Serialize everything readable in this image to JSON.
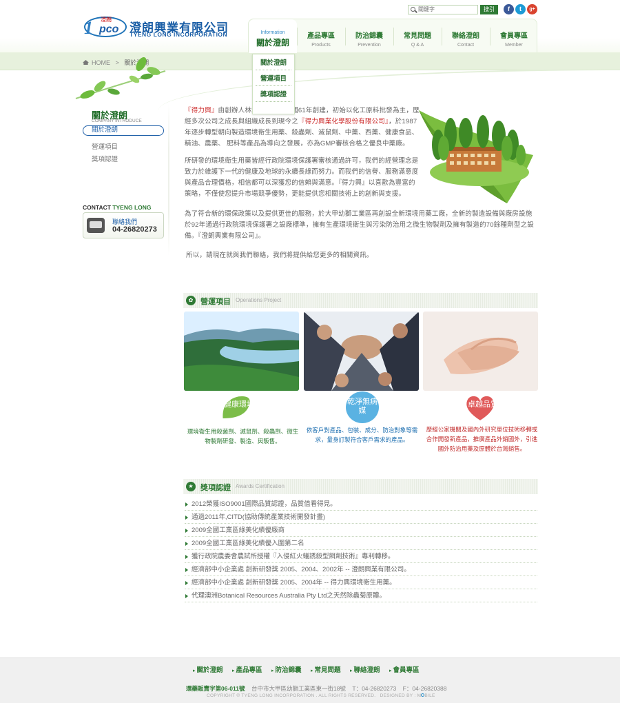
{
  "logo": {
    "mark_sub": "澄朗",
    "mark_num": "1",
    "mark_txt": "pco",
    "name_cn": "澄朗興業有限公司",
    "name_en": "TYENG LONG INCORPORATION"
  },
  "search": {
    "placeholder": "關鍵字",
    "button": "搜引"
  },
  "social": [
    "f",
    "t",
    "g+"
  ],
  "nav": [
    {
      "zh": "關於澄朗",
      "en": "Information"
    },
    {
      "zh": "產品專區",
      "en": "Products"
    },
    {
      "zh": "防治錦囊",
      "en": "Prevention"
    },
    {
      "zh": "常見問題",
      "en": "Q & A"
    },
    {
      "zh": "聯絡澄朗",
      "en": "Contact"
    },
    {
      "zh": "會員專區",
      "en": "Member"
    }
  ],
  "dropdown": [
    "關於澄朗",
    "營運項目",
    "獎項認證"
  ],
  "breadcrumb": {
    "home": "HOME",
    "sep": ">",
    "current": "關於澄朗"
  },
  "sidebar": {
    "title": "關於澄朗",
    "subtitle": "COMPANY INTRODUCE",
    "items": [
      "關於澄朗",
      "營運項目",
      "獎項認證"
    ]
  },
  "contact": {
    "heading_a": "CONTACT",
    "heading_b": "TYENG LONG",
    "label": "聯絡我們",
    "phone": "04-26820273"
  },
  "intro": {
    "p1_a": "『得力興』",
    "p1_b": "由創辦人林清德先生於民國61年創建，初始以化工原料批發為主，歷經多次公司之成長與組織成長到現今之",
    "p1_c": "『得力興業化學股份有限公司』",
    "p1_d": "，於1987年逐步轉型朝向製造環境衛生用藥、殺蟲劑、滅鼠劑、中藥、西藥、健康食品、精油、農藥、 肥料等產品為導向之發展，亦為GMP審核合格之優良中藥廠。",
    "p2": "所研發的環境衛生用藥皆經行政院環境保護署審核通過許可，我們的經營理念是致力於維護下一代的健康及地球的永續長綠而努力。而我們的信譽、服務滿意度與產品合理價格，相信都可以深獲您的信賴與滿意。『得力興』以喜歡為豐富的策略，不僅使您提升市場競爭優勢，更能提供您相關技術上的創新與支援。",
    "p3": "為了符合新的環保政策以及提供更佳的服務，於大甲幼獅工業區再創設全新環境用藥工廠，全新的製造設備與廠房設施於92年通過行政院環境保護署之設廠標準，擁有生產環境衛生與污染防治用之微生物製劑及擁有製造的70餘種劑型之設備。『澄朗興業有限公司』。",
    "p4": "所以，請現在就與我們聯絡，我們將提供給您更多的相關資訊。"
  },
  "operations": {
    "title_zh": "營運項目",
    "title_en": "Operations Project",
    "cards": [
      {
        "badge": "健康環境",
        "color": "#5aa83a",
        "text": "環境衛生用殺菌劑、滅鼠劑、殺蟲劑、微生物製劑研發、製造、與販售。"
      },
      {
        "badge": "乾淨無病媒",
        "color": "#2b8fc9",
        "text": "依客戶對產品、包裝、成分、防治對象等需求，量身訂製符合客戶需求的產品。"
      },
      {
        "badge": "卓越品質",
        "color": "#d23a3a",
        "text": "歷經公家機關及國內外研究單位技術移轉或合作開發新產品，推廣產品外銷國外，引進國外防治用藥及原體於台灣銷售。"
      }
    ]
  },
  "awards": {
    "title_zh": "獎項認證",
    "title_en": "Awards Certification",
    "items": [
      "2012榮獲ISO9001國際品質認證，品質值看得見。",
      "通過2011年,CITD(協助傳統產業技術開發計畫)",
      "2009全國工業區綠美化績優廠商",
      "2009全國工業區綠美化績優入圍第二名",
      "獲行政院農委會農試所授權『入侵紅火蟻誘殺型餌劑技術』專利轉移。",
      "經濟部中小企業處 創新研發獎 2005、2004、2002年 -- 澄朗興業有限公司。",
      "經濟部中小企業處 創新研發獎 2005、2004年 -- 得力興環境衛生用藥。",
      "代理澳洲Botanical Resources Australia Pty Ltd之天然除蟲菊原體。"
    ]
  },
  "footer": {
    "nav": [
      "關於澄朗",
      "產品專區",
      "防治錦囊",
      "常見問題",
      "聯絡澄朗",
      "會員專區"
    ],
    "license_a": "環藥販賣字第",
    "license_b": "06-011號",
    "address": "台中市大甲區幼獅工業區東一街18號",
    "tel": "T：04-26820273",
    "fax": "F：04-26820388",
    "copyright": "COPYRIGHT © TYENG LONG INCORPORATION . ALL RIGHTS RESERVED.",
    "designed": "DESIGNED BY : M",
    "designed_b": "BILE"
  }
}
